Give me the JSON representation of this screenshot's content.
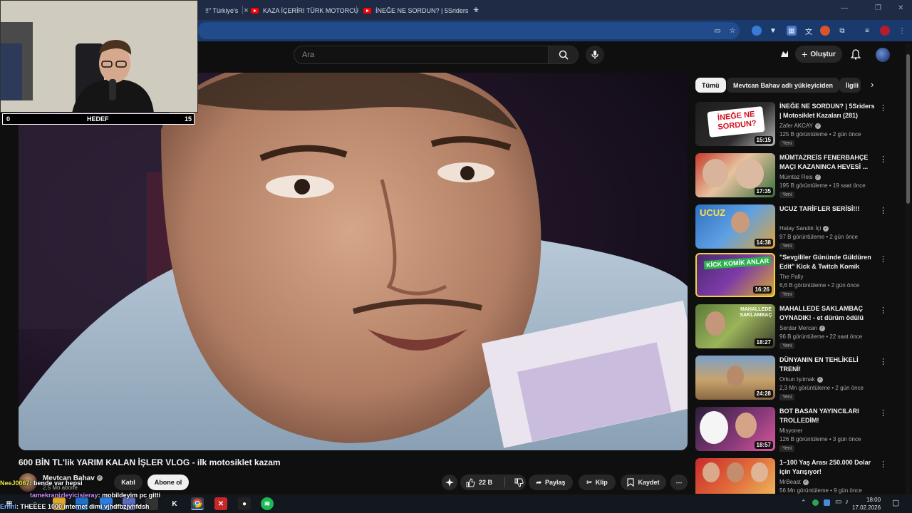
{
  "browser": {
    "tabs": [
      {
        "label": "!!\" Türkiye's"
      },
      {
        "label": "KAZA İÇERİRI TÜRK MOTORCU"
      },
      {
        "label": "İNEĞE NE SORDUN? | 5Sriders"
      }
    ],
    "new_tab": "+",
    "window_controls": [
      "—",
      "❐",
      "✕"
    ]
  },
  "youtube": {
    "search_placeholder": "Ara",
    "create_label": "Oluştur"
  },
  "webcam": {
    "goal_label": "HEDEF",
    "goal_current": "0",
    "goal_target": "15"
  },
  "video": {
    "title": "600 BİN TL'lik YARIM KALAN İŞLER VLOG - ilk motosiklet kazam"
  },
  "channel": {
    "name": "Mevtcan Bahav",
    "subs": "2,5 Mn abone",
    "join_label": "Katıl",
    "subscribe_label": "Abone ol"
  },
  "actions": {
    "likes": "22 B",
    "share": "Paylaş",
    "clip": "Klip",
    "save": "Kaydet",
    "more": "⋯"
  },
  "chips": [
    {
      "label": "Tümü",
      "active": true
    },
    {
      "label": "Mevtcan Bahav adlı yükleyiciden",
      "active": false
    },
    {
      "label": "İlgili",
      "active": false
    }
  ],
  "recommendations": [
    {
      "title": "İNEĞE NE SORDUN? | 5Sriders | Motosiklet Kazaları (281)",
      "channel": "Zafer AKCAY",
      "meta": "125 B görüntüleme • 2 gün önce",
      "badge": "Yeni",
      "duration": "15:15",
      "thumb_text": "İNEĞE NE SORDUN?"
    },
    {
      "title": "MÜMTAZREİS FENERBAHÇE MAÇI KAZANINCA HEVESİ ...",
      "channel": "Mümtaz Reis",
      "meta": "195 B görüntüleme • 19 saat önce",
      "badge": "Yeni",
      "duration": "17:35",
      "thumb_text": ""
    },
    {
      "title": "UCUZ TARİFLER SERİSİ!!!",
      "channel": "Hatay Sandık İçi",
      "meta": "97 B görüntüleme • 2 gün önce",
      "badge": "Yeni",
      "duration": "14:38",
      "thumb_text": "UCUZ"
    },
    {
      "title": "\"Sevgililer Gününde Güldüren Edit\" Kick & Twitch Komik Anla...",
      "channel": "The Pally",
      "meta": "6,6 B görüntüleme • 2 gün önce",
      "badge": "Yeni",
      "duration": "16:26",
      "thumb_text": "KİCK KOMİK ANLAR"
    },
    {
      "title": "MAHALLEDE SAKLAMBAÇ OYNADIK! - et dürüm ödülü",
      "channel": "Serdar Mercan",
      "meta": "96 B görüntüleme • 22 saat önce",
      "badge": "Yeni",
      "duration": "18:27",
      "thumb_text": "MAHALLEDE SAKLAMBAÇ"
    },
    {
      "title": "DÜNYANIN EN TEHLİKELİ TRENİ!",
      "channel": "Orkun Işıtmak",
      "meta": "2,3 Mn görüntüleme • 2 gün önce",
      "badge": "Yeni",
      "duration": "24:28",
      "thumb_text": ""
    },
    {
      "title": "BOT BASAN YAYINCILARI TROLLEDİM!",
      "channel": "Misyoner",
      "meta": "126 B görüntüleme • 3 gün önce",
      "badge": "Yeni",
      "duration": "18:57",
      "thumb_text": ""
    },
    {
      "title": "1–100 Yaş Arası 250.000 Dolar için Yarışıyor!",
      "channel": "MrBeast",
      "meta": "56 Mn görüntüleme • 9 gün önce",
      "badge": "",
      "duration": "",
      "thumb_text": ""
    }
  ],
  "chat": [
    {
      "user": "NeeJ0067",
      "text": ": bende var hepsi",
      "color": "#e8e84a"
    },
    {
      "user": "tamekranizleyicisieray",
      "text": ": mobildeyim pc gitti",
      "color": "#c58af9"
    },
    {
      "user": "Ernnl",
      "text": ": THEEEE 1000 internet dimi vjhdfbzjvhfdsh",
      "color": "#7fb5ff"
    }
  ],
  "taskbar": {
    "time": "18:00",
    "date": "17.02.2026"
  },
  "colors": {
    "youtube_red": "#ff0000",
    "bg": "#0f0f0f",
    "chip": "#272727"
  }
}
